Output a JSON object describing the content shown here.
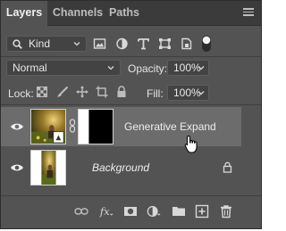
{
  "tabs": [
    {
      "label": "Layers",
      "active": true
    },
    {
      "label": "Channels",
      "active": false
    },
    {
      "label": "Paths",
      "active": false
    }
  ],
  "filter": {
    "kind_label": "Kind"
  },
  "blend": {
    "mode": "Normal",
    "opacity_label": "Opacity:",
    "opacity_value": "100%"
  },
  "lock": {
    "label": "Lock:",
    "fill_label": "Fill:",
    "fill_value": "100%"
  },
  "layers": [
    {
      "name": "Generative Expand",
      "selected": true,
      "has_mask": true
    },
    {
      "name": "Background",
      "selected": false,
      "locked": true
    }
  ],
  "colors": {
    "panel": "#535353",
    "tabbar": "#3b3b3b",
    "selected_row": "#6c6c6c"
  }
}
